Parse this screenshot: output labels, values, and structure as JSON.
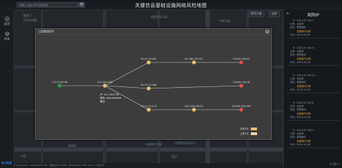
{
  "app_title": "关键信息基础设施网络风险地图",
  "search": {
    "placeholder": "请输入地址/IP/设施搜索",
    "button_label": "搜"
  },
  "left_nav": [
    {
      "label": "监测",
      "icon": "monitor-icon"
    },
    {
      "label": "资源",
      "icon": "layers-icon"
    }
  ],
  "top_controls": [
    {
      "label": "联合大厦"
    },
    {
      "label": "全部"
    }
  ],
  "map_labels": [
    "微盟门",
    "SOHO尚都",
    "首都国际大厦",
    "中国国际贸易中心",
    "中联大厦",
    "国贸",
    "新城区",
    "中国",
    "中国国贸大厦"
  ],
  "right_panel": {
    "title": "风险IP",
    "cards": [
      {
        "ip": "218.107.136.7",
        "loc": "北京市",
        "type": "恶意软件",
        "link": "查看事件详情",
        "time": "2019-01-04"
      },
      {
        "ip": "218.107.136.9",
        "loc": "北京市",
        "type": "恶意软件",
        "link": "查看事件详情",
        "time": "2019-01-04"
      },
      {
        "ip": "218.107.135.12",
        "loc": "北京市",
        "type": "恶意软件",
        "link": "查看事件详情",
        "time": "2019-01-05"
      },
      {
        "ip": "218.107.136.8",
        "loc": "北京市",
        "type": "恶意软件",
        "link": "查看事件详情",
        "time": "2019-01-06"
      },
      {
        "ip": "218.107.136.7",
        "loc": "北京市",
        "type": "恶意软件",
        "link": "查看事件详情",
        "time": "2019-01-06"
      }
    ],
    "pager": "< 1/5 >"
  },
  "dialog": {
    "title": "上层路由拓扑",
    "nodes": [
      {
        "id": "n0",
        "label": "113.5.252.98",
        "kind": "source",
        "color": "#2e9b57"
      },
      {
        "id": "n1",
        "label": "121.120.5.82",
        "kind": "intermediate",
        "color": "#f0c070"
      },
      {
        "id": "n2",
        "label": "61.51.114.82",
        "kind": "intermediate",
        "color": "#f0c070"
      },
      {
        "id": "n3",
        "label": "61.51.113.86",
        "kind": "intermediate",
        "color": "#f0c070"
      },
      {
        "id": "n4",
        "label": "61.51.114.74",
        "kind": "intermediate",
        "color": "#f0c070"
      },
      {
        "id": "n5",
        "label": "61.148.155.222",
        "kind": "intermediate",
        "color": "#f0c070"
      },
      {
        "id": "n6",
        "label": "202.106.228.22",
        "kind": "intermediate",
        "color": "#f0c070"
      },
      {
        "id": "n7",
        "label": "124.65.194.22",
        "kind": "target",
        "color": "#d9534f"
      },
      {
        "id": "n8",
        "label": "124.65.194.18",
        "kind": "target",
        "color": "#d9534f"
      },
      {
        "id": "n9",
        "label": "124.65.194.156",
        "kind": "target",
        "color": "#d9534f"
      }
    ],
    "edges": [
      [
        "n0",
        "n1"
      ],
      [
        "n1",
        "n2"
      ],
      [
        "n1",
        "n3"
      ],
      [
        "n1",
        "n4"
      ],
      [
        "n2",
        "n5"
      ],
      [
        "n3",
        "n8"
      ],
      [
        "n4",
        "n6"
      ],
      [
        "n5",
        "n7"
      ],
      [
        "n6",
        "n9"
      ]
    ],
    "tooltip": [
      "IP: 121.120.5.82",
      "角色: intermediate",
      "路由"
    ],
    "legend": [
      {
        "label": "中间节点",
        "color": "#f0c070"
      },
      {
        "label": "上游节点",
        "color": "#e8d9a8"
      }
    ]
  },
  "status_text": "© 2019 Baidu - GS(2018)5572号 - 甲测资字1100930 - 京ICP证030173号 - Data © 长地万方",
  "brand": "Bai地图"
}
